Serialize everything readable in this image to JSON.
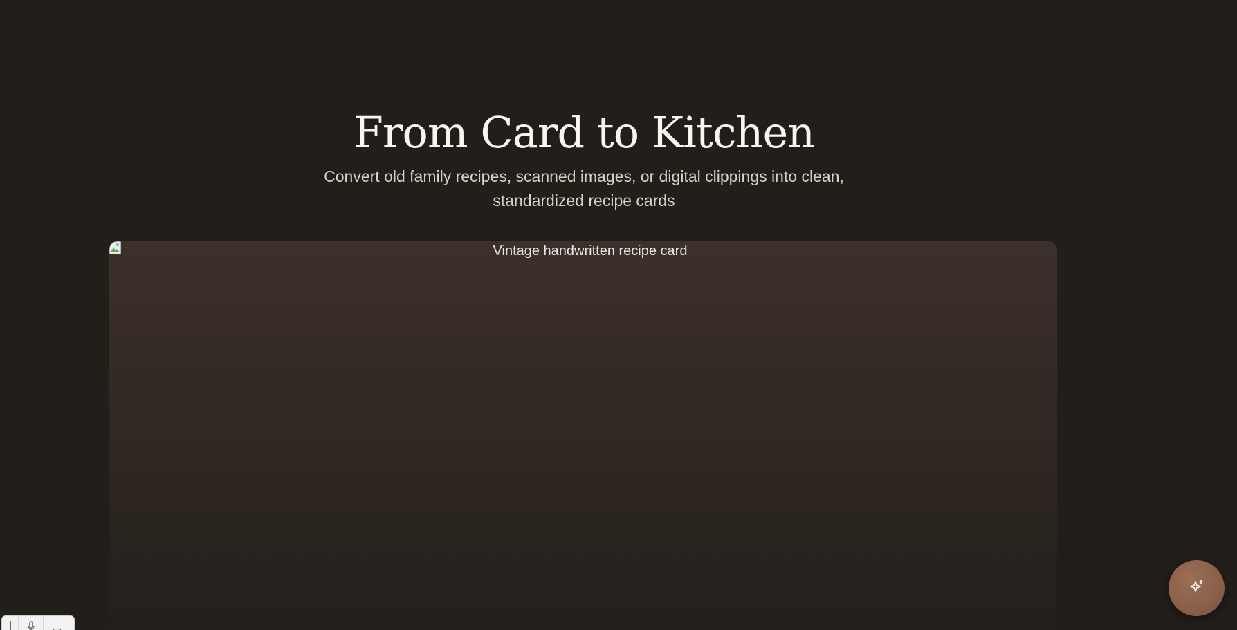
{
  "hero": {
    "title": "From Card to Kitchen",
    "subtitle": "Convert old family recipes, scanned images, or digital clippings into clean, standardized recipe cards"
  },
  "preview_image": {
    "alt": "Vintage handwritten recipe card",
    "icon": "broken-image-icon"
  },
  "fab": {
    "icon": "sparkle-icon",
    "color": "#8a5f48"
  },
  "mini_toolbar": {
    "items": [
      {
        "icon": "grip-icon"
      },
      {
        "icon": "microphone-icon"
      },
      {
        "label": "..."
      }
    ]
  },
  "colors": {
    "background": "#221f1b",
    "title": "#faf6ef",
    "subtitle": "#d9d1c6"
  }
}
